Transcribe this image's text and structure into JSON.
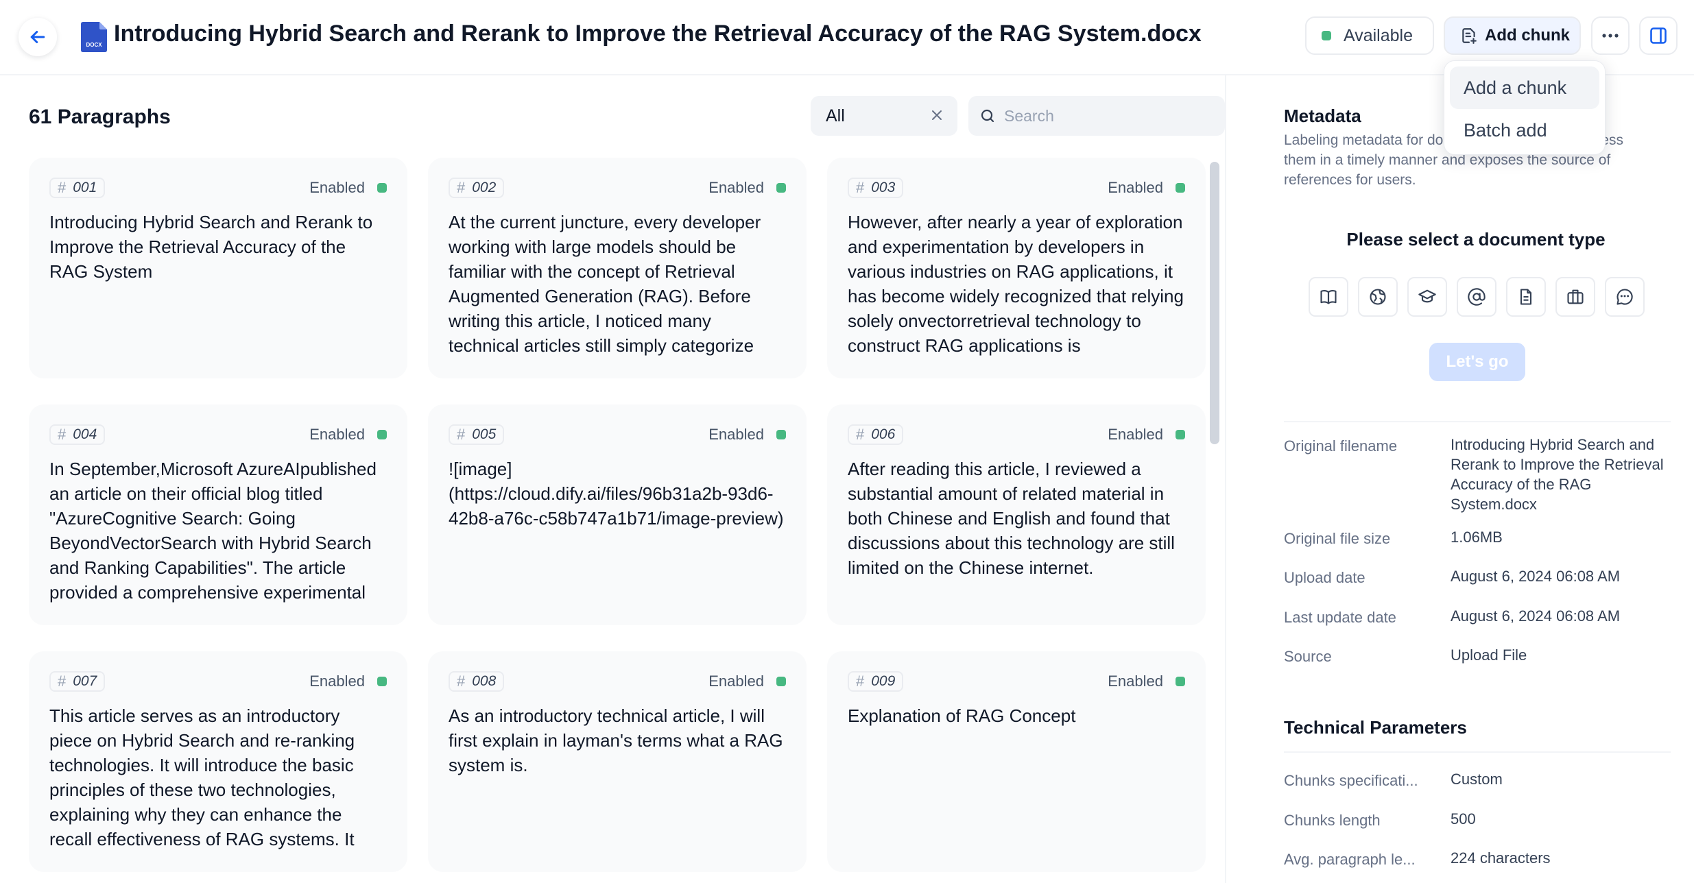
{
  "header": {
    "title": "Introducing Hybrid Search and Rerank to Improve the Retrieval Accuracy of the RAG System.docx",
    "file_badge": "DOCX",
    "status": "Available",
    "add_chunk_label": "Add chunk"
  },
  "dropdown": {
    "items": [
      "Add a chunk",
      "Batch add"
    ]
  },
  "list": {
    "count_label": "61 Paragraphs",
    "filter_value": "All",
    "search_placeholder": "Search"
  },
  "colors": {
    "enabled": "#47b881",
    "accent": "#155eef"
  },
  "cards": [
    {
      "id": "001",
      "state": "Enabled",
      "text": "Introducing Hybrid Search and Rerank to Improve the Retrieval Accuracy of the RAG System"
    },
    {
      "id": "002",
      "state": "Enabled",
      "text": "At the current juncture, every developer working with large models should be familiar with the concept of Retrieval Augmented Generation (RAG). Before writing this article, I noticed many technical articles still simply categorize"
    },
    {
      "id": "003",
      "state": "Enabled",
      "text": "However, after nearly a year of exploration and experimentation by developers in various industries on RAG applications, it has become widely recognized that relying solely onvectorretrieval technology to construct RAG applications is"
    },
    {
      "id": "004",
      "state": "Enabled",
      "text": "In September,Microsoft AzureAIpublished an article on their official blog titled \"AzureCognitive Search: Going BeyondVectorSearch with Hybrid Search and Ranking Capabilities\". The article provided a comprehensive experimental"
    },
    {
      "id": "005",
      "state": "Enabled",
      "text": "![image](https://cloud.dify.ai/files/96b31a2b-93d6-42b8-a76c-c58b747a1b71/image-preview)"
    },
    {
      "id": "006",
      "state": "Enabled",
      "text": "After reading this article, I reviewed a substantial amount of related material in both Chinese and English and found that discussions about this technology are still limited on the Chinese internet."
    },
    {
      "id": "007",
      "state": "Enabled",
      "text": "This article serves as an introductory piece on Hybrid Search and re-ranking technologies. It will introduce the basic principles of these two technologies, explaining why they can enhance the recall effectiveness of RAG systems. It"
    },
    {
      "id": "008",
      "state": "Enabled",
      "text": "As an introductory technical article, I will first explain in layman's terms what a RAG system is."
    },
    {
      "id": "009",
      "state": "Enabled",
      "text": "Explanation of RAG Concept"
    }
  ],
  "metadata": {
    "title": "Metadata",
    "desc_lines": [
      "Labeling metadata for documents allows AI to access",
      "them in a timely manner and exposes the source of",
      "references for users."
    ],
    "select_type": "Please select a document type",
    "type_icons": [
      "book-icon",
      "web-icon",
      "graduation-cap-icon",
      "at-sign-icon",
      "document-icon",
      "briefcase-icon",
      "chat-bubble-icon"
    ],
    "go_label": "Let's go",
    "fields": [
      {
        "label": "Original filename",
        "value": "Introducing Hybrid Search and Rerank to Improve the Retrieval Accuracy of the RAG System.docx"
      },
      {
        "label": "Original file size",
        "value": "1.06MB"
      },
      {
        "label": "Upload date",
        "value": "August 6, 2024 06:08 AM"
      },
      {
        "label": "Last update date",
        "value": "August 6, 2024 06:08 AM"
      },
      {
        "label": "Source",
        "value": "Upload File"
      }
    ]
  },
  "technical": {
    "title": "Technical Parameters",
    "fields": [
      {
        "label": "Chunks specificati...",
        "value": "Custom"
      },
      {
        "label": "Chunks length",
        "value": "500"
      },
      {
        "label": "Avg. paragraph le...",
        "value": "224 characters"
      }
    ]
  }
}
